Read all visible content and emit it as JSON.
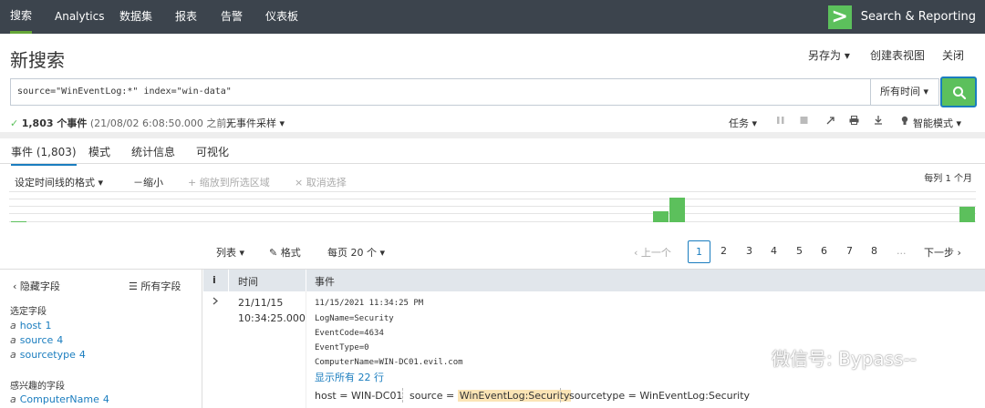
{
  "nav": {
    "items": [
      "搜索",
      "Analytics",
      "数据集",
      "报表",
      "告警",
      "仪表板"
    ],
    "app_name": "Search & Reporting",
    "accent": "#65a637"
  },
  "header": {
    "title": "新搜索",
    "save_as": "另存为 ▾",
    "create_table_view": "创建表视图",
    "close": "关闭"
  },
  "search": {
    "query": "source=\"WinEventLog:*\" index=\"win-data\"",
    "time_range": "所有时间 ▾",
    "button_color": "#5cc05c"
  },
  "status": {
    "check": "✓",
    "event_count": "1,803 个事件",
    "time_note": "(21/08/02 6:08:50.000 之前)",
    "sampling": "无事件采样 ▾",
    "jobs": "任务 ▾",
    "smart_mode": "智能模式 ▾"
  },
  "tabs": [
    "事件 (1,803)",
    "模式",
    "统计信息",
    "可视化"
  ],
  "timeline": {
    "format": "设定时间线的格式 ▾",
    "zoom_out": "－缩小",
    "zoom_selection": "+ 缩放到所选区域",
    "deselect": "× 取消选择",
    "scale": "每列 1 个月"
  },
  "pager": {
    "list": "列表 ▾",
    "format": "格式",
    "per_page": "每页 20 个 ▾",
    "prev": "‹ 上一个",
    "pages": [
      "1",
      "2",
      "3",
      "4",
      "5",
      "6",
      "7",
      "8"
    ],
    "ellipsis": "...",
    "next": "下一步 ›"
  },
  "sidebar": {
    "hide_fields": "‹ 隐藏字段",
    "all_fields": "所有字段",
    "selected_title": "选定字段",
    "selected_fields": [
      {
        "type": "a",
        "name": "host",
        "count": "1"
      },
      {
        "type": "a",
        "name": "source",
        "count": "4"
      },
      {
        "type": "a",
        "name": "sourcetype",
        "count": "4"
      }
    ],
    "interesting_title": "感兴趣的字段",
    "interesting_fields": [
      {
        "type": "a",
        "name": "ComputerName",
        "count": "4"
      }
    ]
  },
  "table": {
    "col_i": "i",
    "col_time": "时间",
    "col_event": "事件",
    "row": {
      "date": "21/11/15",
      "time": "10:34:25.000",
      "lines": [
        "11/15/2021 11:34:25 PM",
        "LogName=Security",
        "EventCode=4634",
        "EventType=0",
        "ComputerName=WIN-DC01.evil.com"
      ],
      "show_all": "显示所有 22 行",
      "host_key": "host = ",
      "host_val": "WIN-DC01",
      "source_key": "source = ",
      "source_val": "WinEventLog:Security",
      "sourcetype_key": "sourcetype = ",
      "sourcetype_val": "WinEventLog:Security"
    }
  },
  "watermark": "微信号: Bypass--"
}
